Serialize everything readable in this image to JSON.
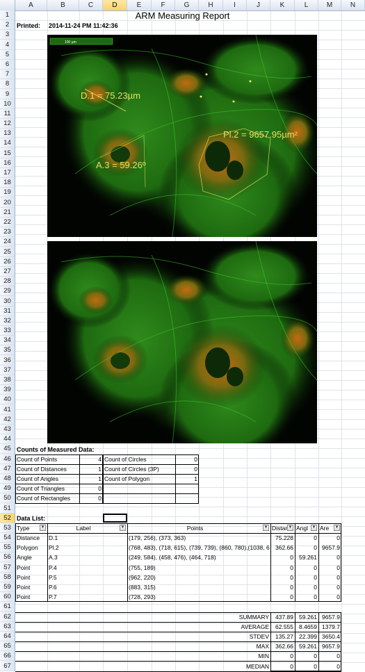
{
  "columns": [
    "A",
    "B",
    "C",
    "D",
    "E",
    "F",
    "G",
    "H",
    "I",
    "J",
    "K",
    "L",
    "M",
    "N"
  ],
  "rows": [
    "1",
    "2",
    "3",
    "4",
    "5",
    "6",
    "7",
    "8",
    "9",
    "10",
    "11",
    "12",
    "13",
    "14",
    "15",
    "16",
    "17",
    "18",
    "19",
    "20",
    "21",
    "22",
    "23",
    "24",
    "25",
    "26",
    "27",
    "28",
    "29",
    "30",
    "31",
    "32",
    "33",
    "34",
    "35",
    "36",
    "37",
    "38",
    "39",
    "40",
    "41",
    "42",
    "43",
    "44",
    "45",
    "46",
    "47",
    "48",
    "49",
    "50",
    "51",
    "52",
    "53",
    "54",
    "55",
    "56",
    "57",
    "58",
    "59",
    "60",
    "61",
    "62",
    "63",
    "64",
    "65",
    "66",
    "67"
  ],
  "report": {
    "title": "ARM Measuring Report",
    "printed_label": "Printed:",
    "printed_value": "2014-11-24 PM 11:42:36"
  },
  "annotations": {
    "scale_bar": "100 µm",
    "distance": "D.1 = 75.23µm",
    "polygon": "Pl.2 = 9657.95µm²",
    "angle": "A.3 = 59.26º"
  },
  "counts": {
    "heading": "Counts of Measured Data:",
    "left": [
      {
        "label": "Count of Points",
        "value": "4"
      },
      {
        "label": "Count of Distances",
        "value": "1"
      },
      {
        "label": "Count of Angles",
        "value": "1"
      },
      {
        "label": "Count of Triangles",
        "value": "0"
      },
      {
        "label": "Count of Rectangles",
        "value": "0"
      }
    ],
    "right": [
      {
        "label": "Count of Circles",
        "value": "0"
      },
      {
        "label": "Count of Circles (3P)",
        "value": "0"
      },
      {
        "label": "Count of Polygon",
        "value": "1"
      }
    ]
  },
  "data_list": {
    "heading": "Data List:",
    "headers": {
      "type": "Type",
      "label": "Label",
      "points": "Points",
      "distance": "Distan",
      "angle": "Angl",
      "area": "Are"
    },
    "rows": [
      {
        "type": "Distance",
        "label": "D.1",
        "points": "(179, 256), (373, 363)",
        "distance": "75.228",
        "angle": "0",
        "area": "0"
      },
      {
        "type": "Polygon",
        "label": "Pl.2",
        "points": "(768, 483), (718, 615), (739, 739), (860, 780),(1038, 6",
        "distance": "362.66",
        "angle": "0",
        "area": "9657.9"
      },
      {
        "type": "Angle",
        "label": "A.3",
        "points": "(249, 584), (458, 476), (464, 718)",
        "distance": "0",
        "angle": "59.261",
        "area": "0"
      },
      {
        "type": "Point",
        "label": "P.4",
        "points": "(755, 189)",
        "distance": "0",
        "angle": "0",
        "area": "0"
      },
      {
        "type": "Point",
        "label": "P.5",
        "points": "(962, 220)",
        "distance": "0",
        "angle": "0",
        "area": "0"
      },
      {
        "type": "Point",
        "label": "P.6",
        "points": "(883, 315)",
        "distance": "0",
        "angle": "0",
        "area": "0"
      },
      {
        "type": "Point",
        "label": "P.7",
        "points": "(728, 293)",
        "distance": "0",
        "angle": "0",
        "area": "0"
      }
    ],
    "summary": [
      {
        "label": "SUMMARY",
        "distance": "437.89",
        "angle": "59.261",
        "area": "9657.9"
      },
      {
        "label": "AVERAGE",
        "distance": "62.555",
        "angle": "8.4659",
        "area": "1379.7"
      },
      {
        "label": "STDEV",
        "distance": "135.27",
        "angle": "22.399",
        "area": "3650.4"
      },
      {
        "label": "MAX",
        "distance": "362.66",
        "angle": "59.261",
        "area": "9657.9"
      },
      {
        "label": "MIN",
        "distance": "0",
        "angle": "0",
        "area": "0"
      },
      {
        "label": "MEDIAN",
        "distance": "0",
        "angle": "0",
        "area": "0"
      }
    ]
  },
  "colors": {
    "annotation": "#e8e060",
    "grid": "#dde3ea",
    "header_bg": "#dbe4f0",
    "selected_header": "#f9d36a"
  }
}
